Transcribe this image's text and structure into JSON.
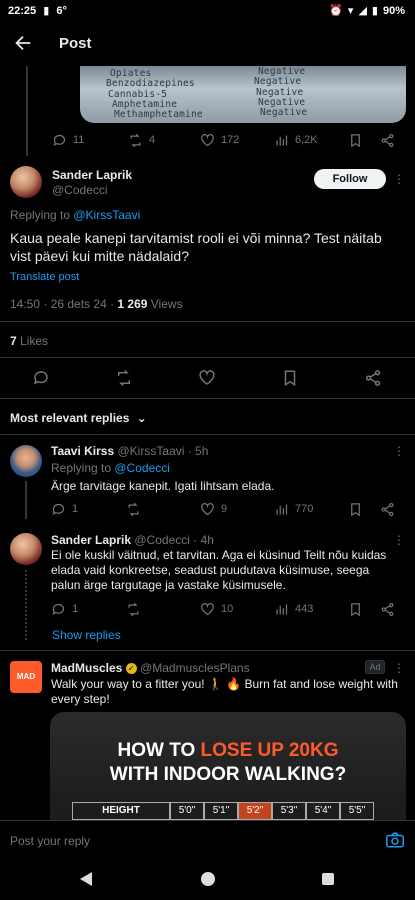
{
  "status_bar": {
    "time": "22:25",
    "temp": "6°",
    "battery": "90%"
  },
  "header": {
    "title": "Post"
  },
  "media_labels": [
    "Opiates",
    "Benzodiazepines",
    "Cannabis-5",
    "Amphetamine",
    "Methamphetamine",
    "Negative",
    "Negative",
    "Negative",
    "Negative",
    "Negative"
  ],
  "parent_actions": {
    "replies": "11",
    "reposts": "4",
    "likes": "172",
    "views": "6,2K"
  },
  "main_post": {
    "name": "Sander Laprik",
    "handle": "@Codecci",
    "follow": "Follow",
    "replying_prefix": "Replying to ",
    "replying_to": "@KirssTaavi",
    "text": "Kaua peale kanepi tarvitamist rooli ei või minna? Test näitab vist päevi kui mitte nädalaid?",
    "translate": "Translate post",
    "time_date": "14:50 · 26 dets 24 · ",
    "views_count": "1 269",
    "views_label": " Views",
    "likes_count": "7",
    "likes_label": " Likes"
  },
  "replies_sort": "Most relevant replies",
  "replies": [
    {
      "name": "Taavi Kirss",
      "handle": "@KirssTaavi · 5h",
      "replying_prefix": "Replying to ",
      "replying_to": "@Codecci",
      "text": "Ärge tarvitage kanepit. Igati lihtsam elada.",
      "replies": "1",
      "reposts": "",
      "likes": "9",
      "views": "770"
    },
    {
      "name": "Sander Laprik",
      "handle": "@Codecci · 4h",
      "text": "Ei ole kuskil väitnud, et tarvitan. Aga ei küsinud Teilt nõu kuidas elada vaid konkreetse, seadust puudutava küsimuse, seega palun ärge targutage ja vastake küsimusele.",
      "replies": "1",
      "reposts": "",
      "likes": "10",
      "views": "443"
    }
  ],
  "show_replies": "Show replies",
  "ad": {
    "name": "MadMuscles",
    "handle": "@MadmusclesPlans",
    "badge": "Ad",
    "logo_text": "MAD",
    "text": "Walk your way to a fitter you! 🚶 🔥 Burn fat and lose weight with every step!",
    "headline_white": "HOW TO ",
    "headline_orange": "LOSE UP 20KG",
    "headline_line2": "WITH INDOOR WALKING?",
    "table": [
      "HEIGHT",
      "5'0\"",
      "5'1\"",
      "5'2\"",
      "5'3\"",
      "5'4\"",
      "5'5\""
    ]
  },
  "compose": {
    "placeholder": "Post your reply"
  },
  "colors": {
    "accent": "#1d9bf0",
    "bg": "#000000",
    "muted": "#71767b",
    "ad_orange": "#ff5a2a"
  }
}
